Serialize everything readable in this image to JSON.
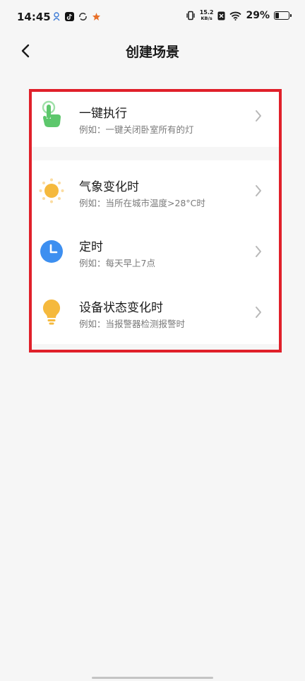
{
  "status_bar": {
    "time": "14:45",
    "net_speed_value": "15.2",
    "net_speed_unit": "KB/s",
    "battery_percent": "29%",
    "battery_level": 0.29,
    "icons": [
      "notification-icon",
      "tiktok-icon",
      "sync-icon",
      "app-icon",
      "vibrate-icon",
      "no-sim-icon",
      "wifi-icon",
      "battery-icon"
    ]
  },
  "header": {
    "title": "创建场景",
    "back_icon": "back-arrow-icon"
  },
  "scenes": [
    {
      "title": "一键执行",
      "subtitle": "例如：一键关闭卧室所有的灯",
      "icon": "tap-hand-icon",
      "color": "#5dc76c"
    },
    {
      "title": "气象变化时",
      "subtitle": "例如：当所在城市温度>28°C时",
      "icon": "sun-icon",
      "color": "#f5b93d"
    },
    {
      "title": "定时",
      "subtitle": "例如：每天早上7点",
      "icon": "clock-icon",
      "color": "#3d8ff0"
    },
    {
      "title": "设备状态变化时",
      "subtitle": "例如：当报警器检测报警时",
      "icon": "lightbulb-icon",
      "color": "#f5b93d"
    }
  ],
  "colors": {
    "highlight": "#e0202a",
    "background": "#f6f6f6",
    "card": "#ffffff"
  }
}
